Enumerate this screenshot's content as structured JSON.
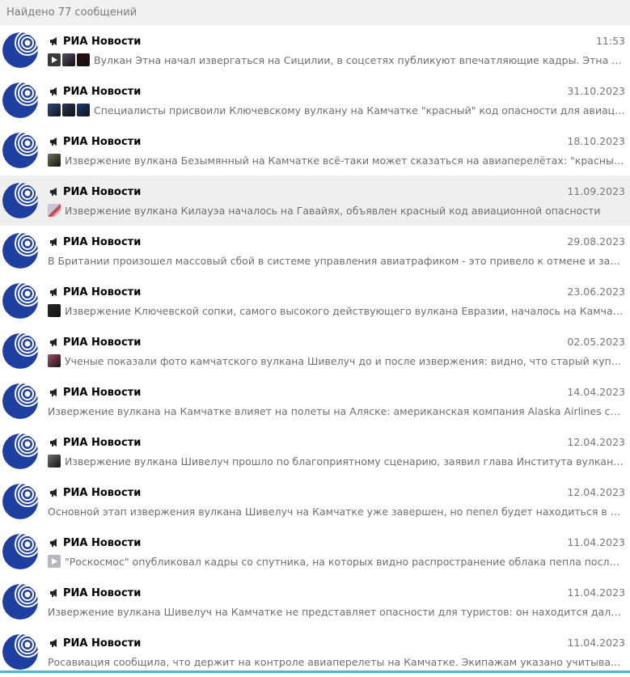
{
  "header": {
    "title": "Найдено 77 сообщений"
  },
  "colors": {
    "avatar_blue": "#1e3fa0",
    "selected_bg": "#efefef"
  },
  "results": [
    {
      "channel": "РИА Новости",
      "date": "11:53",
      "thumbs": [
        "#3a3a3a|play",
        "#5a4a66",
        "#2a0d0d"
      ],
      "text": "Вулкан Этна начал извергаться на Сицилии, в соцсетях публикуют впечатляющие кадры.  Этна - один из ...",
      "selected": false
    },
    {
      "channel": "РИА Новости",
      "date": "31.10.2023",
      "thumbs": [
        "#2d4a8a",
        "#2b3556",
        "#1b3d7a"
      ],
      "text": "Специалисты присвоили Ключевскому вулкану на Камчатке \"красный\" код опасности для авиации из-за ...",
      "selected": false
    },
    {
      "channel": "РИА Новости",
      "date": "18.10.2023",
      "thumbs": [
        "#6d7a52"
      ],
      "text": "Извержение вулкана Безымянный на Камчатке всё-таки может сказаться на авиаперелётах: \"красный код\" о...",
      "selected": false
    },
    {
      "channel": "РИА Новости",
      "date": "11.09.2023",
      "thumbs": [
        "#c9c4d9|red"
      ],
      "text": "Извержение вулкана Килауэа началось на Гавайях, объявлен красный код авиационной опасности",
      "selected": true
    },
    {
      "channel": "РИА Новости",
      "date": "29.08.2023",
      "thumbs": [],
      "text": "В Британии произошел массовый сбой в системе управления авиатрафиком - это привело к отмене и задержке ...",
      "selected": false
    },
    {
      "channel": "РИА Новости",
      "date": "23.06.2023",
      "thumbs": [
        "#2a2a2a"
      ],
      "text": "Извержение Ключевской сопки, самого высокого действующего вулкана Евразии, началось на Камчатке, со...",
      "selected": false
    },
    {
      "channel": "РИА Новости",
      "date": "02.05.2023",
      "thumbs": [
        "#a4506a"
      ],
      "text": "Ученые показали фото камчатского вулкана Шивелуч до и после извержения: видно, что старый купол заме...",
      "selected": false
    },
    {
      "channel": "РИА Новости",
      "date": "14.04.2023",
      "thumbs": [],
      "text": "Извержение вулкана на Камчатке влияет на полеты на Аляске: американская компания Alaska Airlines сообщила ...",
      "selected": false
    },
    {
      "channel": "РИА Новости",
      "date": "12.04.2023",
      "thumbs": [
        "#76706a"
      ],
      "text": "Извержение вулкана Шивелуч прошло по благоприятному сценарию, заявил глава Института вулканологии ...",
      "selected": false
    },
    {
      "channel": "РИА Новости",
      "date": "12.04.2023",
      "thumbs": [],
      "text": "Основной этап извержения вулкана Шивелуч на Камчатке уже завершен, но пепел будет находиться в атмосфе...",
      "selected": false
    },
    {
      "channel": "РИА Новости",
      "date": "11.04.2023",
      "thumbs": [
        "#b8b8c4|play"
      ],
      "text": "\"Роскосмос\" опубликовал кадры со спутника, на которых видно распространение облака пепла после изверж...",
      "selected": false
    },
    {
      "channel": "РИА Новости",
      "date": "11.04.2023",
      "thumbs": [],
      "text": "Извержение вулкана Шивелуч на Камчатке не представляет опасности для туристов: он находится далеко от осн...",
      "selected": false
    },
    {
      "channel": "РИА Новости",
      "date": "11.04.2023",
      "thumbs": [],
      "text": "Росавиация сообщила, что держит на контроле авиаперелеты на Камчатке. Экипажам указано учитывать изверж...",
      "selected": false
    }
  ]
}
